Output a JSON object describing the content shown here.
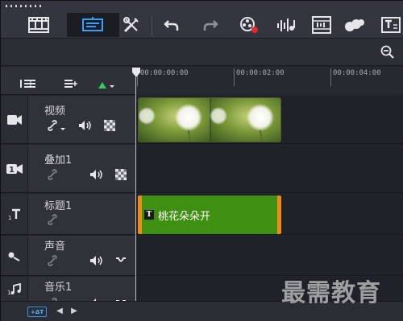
{
  "toolbar": {
    "buttons": [
      {
        "name": "storyboard-view",
        "icon": "film-strip-icon"
      },
      {
        "name": "timeline-view",
        "icon": "timeline-icon",
        "active": true
      },
      {
        "name": "toolbox",
        "icon": "tools-icon"
      },
      {
        "name": "undo",
        "icon": "undo-icon"
      },
      {
        "name": "redo",
        "icon": "redo-icon"
      },
      {
        "name": "record-capture",
        "icon": "record-capture-icon"
      },
      {
        "name": "sound-mixer",
        "icon": "sound-mixer-icon"
      },
      {
        "name": "auto-music",
        "icon": "auto-music-icon"
      },
      {
        "name": "motion-tracking",
        "icon": "motion-tracking-icon"
      },
      {
        "name": "subtitle-editor",
        "icon": "subtitle-icon"
      }
    ]
  },
  "ruler": {
    "labels": [
      "00:00:00:00",
      "00:00:02:00",
      "00:00:04:00"
    ]
  },
  "tracks": [
    {
      "name": "视频",
      "type": "video-track-icon"
    },
    {
      "name": "叠加1",
      "type": "overlay-track-icon"
    },
    {
      "name": "标题1",
      "type": "title-track-icon"
    },
    {
      "name": "声音",
      "type": "voice-track-icon"
    },
    {
      "name": "音乐1",
      "type": "music-track-icon"
    }
  ],
  "clips": {
    "title_clip_text": "桃花朵朵开"
  },
  "bottom": {
    "add_track_label": "+ΔT"
  },
  "watermark": "最需教育",
  "colors": {
    "accent": "#2f8fe6",
    "title_clip": "#3f8f12",
    "title_clip_border": "#f08a12",
    "background": "#22252c"
  }
}
